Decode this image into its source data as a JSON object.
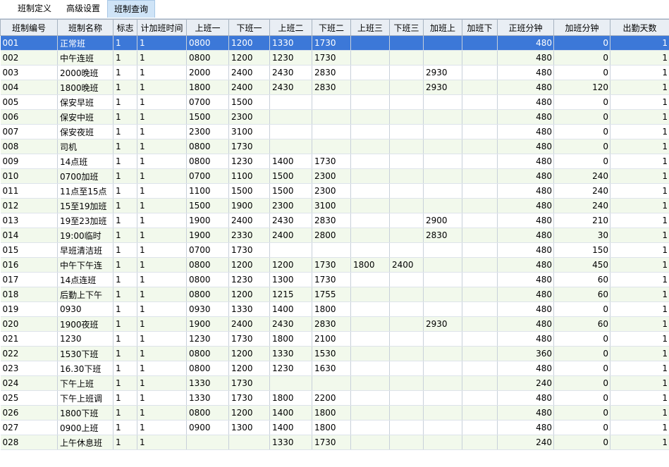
{
  "tabs": [
    {
      "label": "班制定义",
      "active": false
    },
    {
      "label": "高级设置",
      "active": false
    },
    {
      "label": "班制查询",
      "active": true
    }
  ],
  "columns": [
    "班制编号",
    "班制名称",
    "标志",
    "计加班时间",
    "上班一",
    "下班一",
    "上班二",
    "下班二",
    "上班三",
    "下班三",
    "加班上",
    "加班下",
    "正班分钟",
    "加班分钟",
    "出勤天数"
  ],
  "rows": [
    [
      "001",
      "正常班",
      "1",
      "1",
      "0800",
      "1200",
      "1330",
      "1730",
      "",
      "",
      "",
      "",
      "480",
      "0",
      "1"
    ],
    [
      "002",
      "中午连班",
      "1",
      "1",
      "0800",
      "1200",
      "1230",
      "1730",
      "",
      "",
      "",
      "",
      "480",
      "0",
      "1"
    ],
    [
      "003",
      "2000晚班",
      "1",
      "1",
      "2000",
      "2400",
      "2430",
      "2830",
      "",
      "",
      "2930",
      "",
      "480",
      "0",
      "1"
    ],
    [
      "004",
      "1800晚班",
      "1",
      "1",
      "1800",
      "2400",
      "2430",
      "2830",
      "",
      "",
      "2930",
      "",
      "480",
      "120",
      "1"
    ],
    [
      "005",
      "保安早班",
      "1",
      "1",
      "0700",
      "1500",
      "",
      "",
      "",
      "",
      "",
      "",
      "480",
      "0",
      "1"
    ],
    [
      "006",
      "保安中班",
      "1",
      "1",
      "1500",
      "2300",
      "",
      "",
      "",
      "",
      "",
      "",
      "480",
      "0",
      "1"
    ],
    [
      "007",
      "保安夜班",
      "1",
      "1",
      "2300",
      "3100",
      "",
      "",
      "",
      "",
      "",
      "",
      "480",
      "0",
      "1"
    ],
    [
      "008",
      "司机",
      "1",
      "1",
      "0800",
      "1730",
      "",
      "",
      "",
      "",
      "",
      "",
      "480",
      "0",
      "1"
    ],
    [
      "009",
      "14点班",
      "1",
      "1",
      "0800",
      "1230",
      "1400",
      "1730",
      "",
      "",
      "",
      "",
      "480",
      "0",
      "1"
    ],
    [
      "010",
      "0700加班",
      "1",
      "1",
      "0700",
      "1100",
      "1500",
      "2300",
      "",
      "",
      "",
      "",
      "480",
      "240",
      "1"
    ],
    [
      "011",
      "11点至15点",
      "1",
      "1",
      "1100",
      "1500",
      "1500",
      "2300",
      "",
      "",
      "",
      "",
      "480",
      "240",
      "1"
    ],
    [
      "012",
      "15至19加班",
      "1",
      "1",
      "1500",
      "1900",
      "2300",
      "3100",
      "",
      "",
      "",
      "",
      "480",
      "240",
      "1"
    ],
    [
      "013",
      "19至23加班",
      "1",
      "1",
      "1900",
      "2400",
      "2430",
      "2830",
      "",
      "",
      "2900",
      "",
      "480",
      "210",
      "1"
    ],
    [
      "014",
      "19:00临时",
      "1",
      "1",
      "1900",
      "2330",
      "2400",
      "2800",
      "",
      "",
      "2830",
      "",
      "480",
      "30",
      "1"
    ],
    [
      "015",
      "早班清洁班",
      "1",
      "1",
      "0700",
      "1730",
      "",
      "",
      "",
      "",
      "",
      "",
      "480",
      "150",
      "1"
    ],
    [
      "016",
      "中午下午连",
      "1",
      "1",
      "0800",
      "1200",
      "1200",
      "1730",
      "1800",
      "2400",
      "",
      "",
      "480",
      "450",
      "1"
    ],
    [
      "017",
      "14点连班",
      "1",
      "1",
      "0800",
      "1230",
      "1300",
      "1730",
      "",
      "",
      "",
      "",
      "480",
      "60",
      "1"
    ],
    [
      "018",
      "后勤上下午",
      "1",
      "1",
      "0800",
      "1200",
      "1215",
      "1755",
      "",
      "",
      "",
      "",
      "480",
      "60",
      "1"
    ],
    [
      "019",
      "0930",
      "1",
      "1",
      "0930",
      "1330",
      "1400",
      "1800",
      "",
      "",
      "",
      "",
      "480",
      "0",
      "1"
    ],
    [
      "020",
      "1900夜班",
      "1",
      "1",
      "1900",
      "2400",
      "2430",
      "2830",
      "",
      "",
      "2930",
      "",
      "480",
      "60",
      "1"
    ],
    [
      "021",
      "1230",
      "1",
      "1",
      "1230",
      "1730",
      "1800",
      "2100",
      "",
      "",
      "",
      "",
      "480",
      "0",
      "1"
    ],
    [
      "022",
      "1530下班",
      "1",
      "1",
      "0800",
      "1200",
      "1330",
      "1530",
      "",
      "",
      "",
      "",
      "360",
      "0",
      "1"
    ],
    [
      "023",
      "16.30下班",
      "1",
      "1",
      "0800",
      "1200",
      "1230",
      "1630",
      "",
      "",
      "",
      "",
      "480",
      "0",
      "1"
    ],
    [
      "024",
      "下午上班",
      "1",
      "1",
      "1330",
      "1730",
      "",
      "",
      "",
      "",
      "",
      "",
      "240",
      "0",
      "1"
    ],
    [
      "025",
      "下午上班调",
      "1",
      "1",
      "1330",
      "1730",
      "1800",
      "2200",
      "",
      "",
      "",
      "",
      "480",
      "0",
      "1"
    ],
    [
      "026",
      "1800下班",
      "1",
      "1",
      "0800",
      "1200",
      "1400",
      "1800",
      "",
      "",
      "",
      "",
      "480",
      "0",
      "1"
    ],
    [
      "027",
      "0900上班",
      "1",
      "1",
      "0900",
      "1300",
      "1400",
      "1800",
      "",
      "",
      "",
      "",
      "480",
      "0",
      "1"
    ],
    [
      "028",
      "上午休息班",
      "1",
      "1",
      "",
      "",
      "1330",
      "1730",
      "",
      "",
      "",
      "",
      "240",
      "0",
      "1"
    ]
  ],
  "selected_row": 0,
  "colors": {
    "selected_bg": "#3c78d8",
    "alt_row_bg": "#f2f9ec",
    "header_bg": "#e9eef4",
    "active_tab_bg": "#cfe4f7"
  }
}
